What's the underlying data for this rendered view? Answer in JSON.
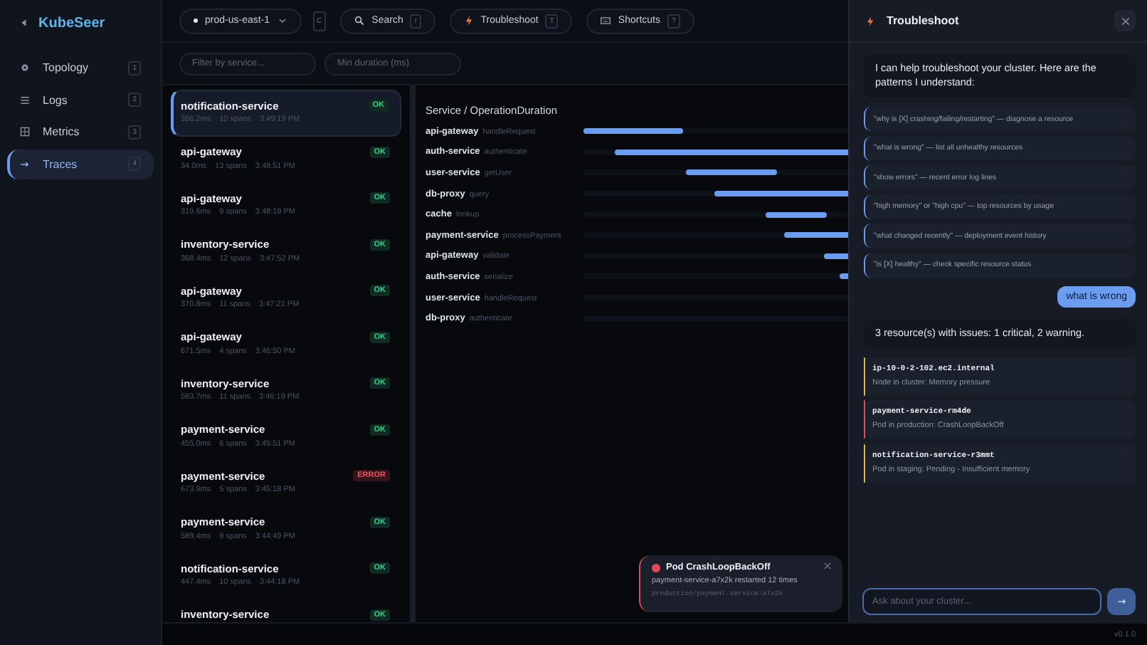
{
  "app": {
    "name": "KubeSeer"
  },
  "sidebar": {
    "items": [
      {
        "label": "Topology",
        "shortcut": "1",
        "selected": false
      },
      {
        "label": "Logs",
        "shortcut": "2",
        "selected": false
      },
      {
        "label": "Metrics",
        "shortcut": "3",
        "selected": false
      },
      {
        "label": "Traces",
        "shortcut": "4",
        "selected": true
      }
    ]
  },
  "topbar": {
    "cluster": {
      "value": "prod-us-east-1",
      "shortcut": "C"
    },
    "buttons": [
      {
        "label": "Search",
        "shortcut": "/"
      },
      {
        "label": "Troubleshoot",
        "shortcut": "T"
      },
      {
        "label": "Shortcuts",
        "shortcut": "?"
      }
    ]
  },
  "filters": [
    {
      "placeholder": "Filter by service..."
    },
    {
      "placeholder": "Min duration (ms)"
    }
  ],
  "traces": [
    {
      "service": "notification-service",
      "duration": "366.2ms",
      "spans": "10 spans",
      "time": "3:49:19 PM",
      "status": "OK",
      "failed": false,
      "selected": true
    },
    {
      "service": "api-gateway",
      "duration": "34.0ms",
      "spans": "13 spans",
      "time": "3:48:51 PM",
      "status": "OK",
      "failed": false,
      "selected": false
    },
    {
      "service": "api-gateway",
      "duration": "319.6ms",
      "spans": "9 spans",
      "time": "3:48:19 PM",
      "status": "OK",
      "failed": false,
      "selected": false
    },
    {
      "service": "inventory-service",
      "duration": "368.4ms",
      "spans": "12 spans",
      "time": "3:47:52 PM",
      "status": "OK",
      "failed": false,
      "selected": false
    },
    {
      "service": "api-gateway",
      "duration": "370.8ms",
      "spans": "11 spans",
      "time": "3:47:21 PM",
      "status": "OK",
      "failed": false,
      "selected": false
    },
    {
      "service": "api-gateway",
      "duration": "671.5ms",
      "spans": "4 spans",
      "time": "3:46:50 PM",
      "status": "OK",
      "failed": false,
      "selected": false
    },
    {
      "service": "inventory-service",
      "duration": "583.7ms",
      "spans": "11 spans",
      "time": "3:46:19 PM",
      "status": "OK",
      "failed": false,
      "selected": false
    },
    {
      "service": "payment-service",
      "duration": "455.0ms",
      "spans": "6 spans",
      "time": "3:45:51 PM",
      "status": "OK",
      "failed": false,
      "selected": false
    },
    {
      "service": "payment-service",
      "duration": "673.9ms",
      "spans": "5 spans",
      "time": "3:45:18 PM",
      "status": "ERROR",
      "failed": true,
      "selected": false
    },
    {
      "service": "payment-service",
      "duration": "589.4ms",
      "spans": "9 spans",
      "time": "3:44:49 PM",
      "status": "OK",
      "failed": false,
      "selected": false
    },
    {
      "service": "notification-service",
      "duration": "447.4ms",
      "spans": "10 spans",
      "time": "3:44:18 PM",
      "status": "OK",
      "failed": false,
      "selected": false
    },
    {
      "service": "inventory-service",
      "status": "OK",
      "failed": false,
      "selected": false
    }
  ],
  "gantt": {
    "header": "Service / OperationDuration",
    "rows": [
      {
        "service": "api-gateway",
        "operation": "handleRequest"
      },
      {
        "service": "auth-service",
        "operation": "authenticate"
      },
      {
        "service": "user-service",
        "operation": "getUser"
      },
      {
        "service": "db-proxy",
        "operation": "query"
      },
      {
        "service": "cache",
        "operation": "lookup"
      },
      {
        "service": "payment-service",
        "operation": "processPayment"
      },
      {
        "service": "api-gateway",
        "operation": "validate"
      },
      {
        "service": "auth-service",
        "operation": "serialize"
      },
      {
        "service": "user-service",
        "operation": "handleRequest"
      },
      {
        "service": "db-proxy",
        "operation": "authenticate"
      }
    ]
  },
  "drawer": {
    "title": "Troubleshoot",
    "messages": [
      {
        "kind": "bot",
        "text": "I can help troubleshoot your cluster. Here are the patterns I understand:"
      },
      {
        "kind": "pattern",
        "text": "\"why is [X] crashing/failing/restarting\" — diagnose a resource"
      },
      {
        "kind": "pattern",
        "text": "\"what is wrong\" — list all unhealthy resources"
      },
      {
        "kind": "pattern",
        "text": "\"show errors\" — recent error log lines"
      },
      {
        "kind": "pattern",
        "text": "\"high memory\" or \"high cpu\" — top resources by usage"
      },
      {
        "kind": "pattern",
        "text": "\"what changed recently\" — deployment event history"
      },
      {
        "kind": "pattern",
        "text": "\"is [X] healthy\" — check specific resource status"
      },
      {
        "kind": "user",
        "text": "what is wrong"
      },
      {
        "kind": "bot",
        "text": "3 resource(s) with issues: 1 critical, 2 warning."
      },
      {
        "kind": "resource",
        "color": "#e0b64a",
        "name": "ip-10-0-2-102.ec2.internal",
        "text": "Node in cluster: Memory pressure"
      },
      {
        "kind": "resource",
        "color": "#d9505e",
        "name": "payment-service-rm4de",
        "text": "Pod in production: CrashLoopBackOff"
      },
      {
        "kind": "resource",
        "color": "#e0b64a",
        "name": "notification-service-r3mmt",
        "text": "Pod in staging: Pending - Insufficient memory"
      }
    ],
    "input": {
      "placeholder": "Ask about your cluster..."
    }
  },
  "toast": {
    "title": "Pod CrashLoopBackOff",
    "message": "payment-service-a7x2k restarted 12 times",
    "path": "production/payment-service-a7x2k"
  },
  "footer": {
    "version": "v0.1.0"
  }
}
